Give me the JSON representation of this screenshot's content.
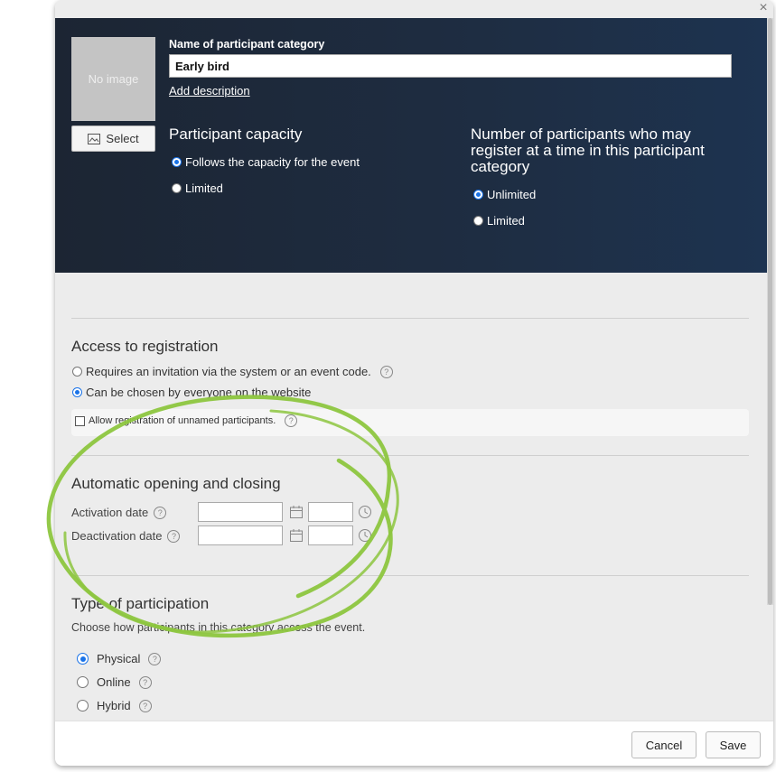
{
  "dialog": {
    "close_glyph": "×"
  },
  "header": {
    "no_image_text": "No image",
    "select_label": "Select",
    "name_label": "Name of participant category",
    "name_value": "Early bird",
    "add_description": "Add description",
    "capacity": {
      "title": "Participant capacity",
      "options": [
        "Follows the capacity for the event",
        "Limited"
      ],
      "selected_index": 0
    },
    "per_registration": {
      "title_line1": "Number of participants who may",
      "title_line2": "register at a time in this participant",
      "title_line3": "category",
      "options": [
        "Unlimited",
        "Limited"
      ],
      "selected_index": 0
    }
  },
  "access": {
    "title": "Access to registration",
    "options": [
      "Requires an invitation via the system or an event code.",
      "Can be chosen by everyone on the website"
    ],
    "selected_index": 1,
    "unnamed_label": "Allow registration of unnamed participants.",
    "unnamed_checked": false
  },
  "auto": {
    "title": "Automatic opening and closing",
    "activation_label": "Activation date",
    "deactivation_label": "Deactivation date"
  },
  "participation": {
    "title": "Type of participation",
    "subtitle": "Choose how participants in this category access the event.",
    "options": [
      "Physical",
      "Online",
      "Hybrid"
    ],
    "selected_index": 0
  },
  "footer": {
    "cancel_label": "Cancel",
    "save_label": "Save"
  },
  "help_glyph": "?",
  "colors": {
    "header_bg": "#1e2d42",
    "accent": "#1a73e8",
    "annotation": "#8dc63f"
  }
}
